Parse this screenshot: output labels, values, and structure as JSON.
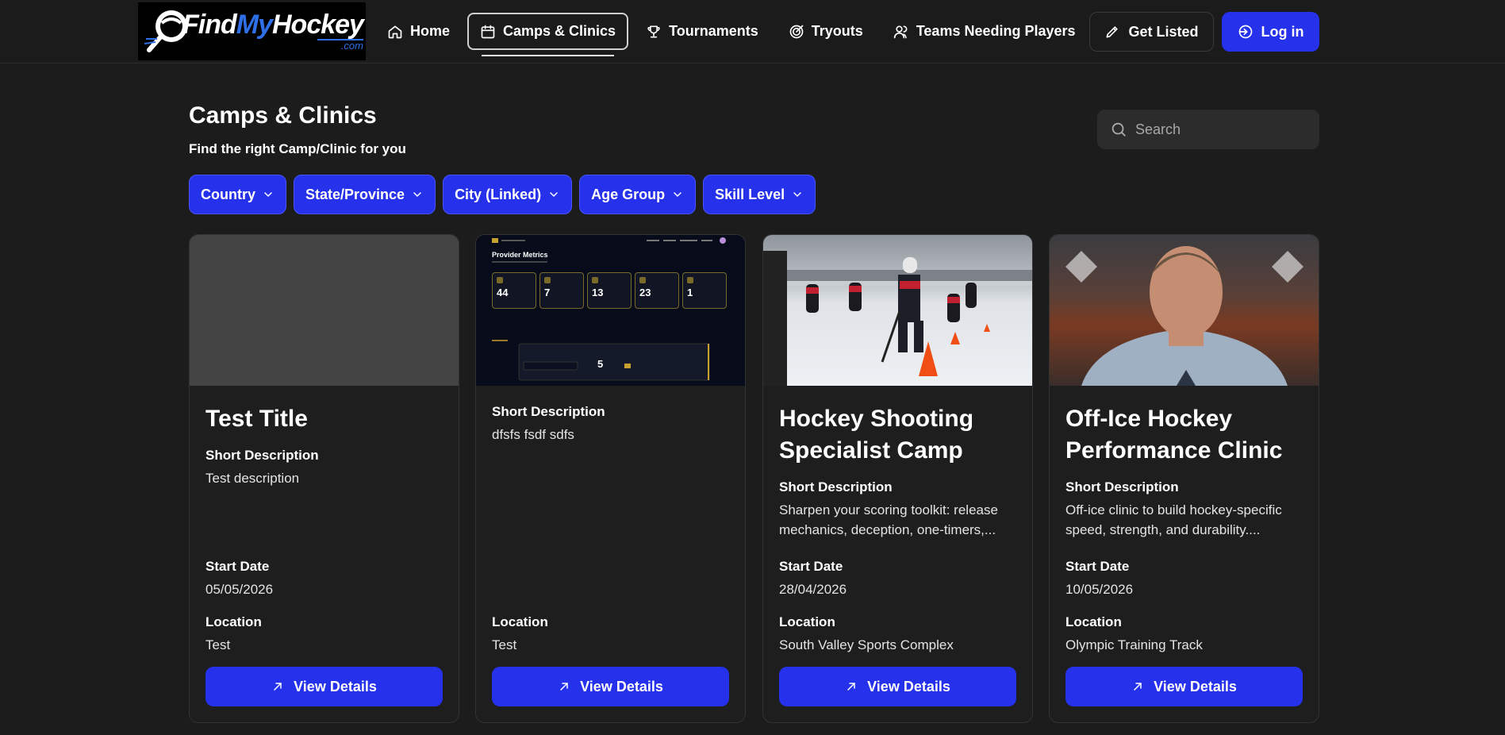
{
  "brand": {
    "logo_main_a": "Find",
    "logo_main_b": "My",
    "logo_main_c": "Hockey",
    "logo_sub": ".com"
  },
  "nav": {
    "items": [
      {
        "label": "Home",
        "icon": "home-icon"
      },
      {
        "label": "Camps & Clinics",
        "icon": "calendar-icon",
        "active": true
      },
      {
        "label": "Tournaments",
        "icon": "trophy-icon"
      },
      {
        "label": "Tryouts",
        "icon": "target-icon"
      },
      {
        "label": "Teams Needing Players",
        "icon": "users-icon"
      }
    ],
    "get_listed": "Get Listed",
    "log_in": "Log in"
  },
  "page": {
    "title": "Camps & Clinics",
    "subtitle": "Find the right Camp/Clinic for you",
    "search_placeholder": "Search"
  },
  "filters": [
    "Country",
    "State/Province",
    "City (Linked)",
    "Age Group",
    "Skill Level"
  ],
  "labels": {
    "short_description": "Short Description",
    "start_date": "Start Date",
    "location": "Location",
    "view_details": "View Details"
  },
  "cards": [
    {
      "title": "Test Title",
      "description": "Test description",
      "start_date": "05/05/2026",
      "location": "Test"
    },
    {
      "title": "",
      "description": "dfsfs fsdf sdfs",
      "start_date": "",
      "location": "Test",
      "thumb": {
        "heading": "Provider Metrics",
        "metrics": [
          "44",
          "7",
          "13",
          "23",
          "1"
        ],
        "stat": "5"
      }
    },
    {
      "title": "Hockey Shooting Specialist Camp",
      "description": "Sharpen your scoring toolkit: release mechanics, deception, one-timers,...",
      "start_date": "28/04/2026",
      "location": "South Valley Sports Complex"
    },
    {
      "title": "Off-Ice Hockey Performance Clinic",
      "description": "Off-ice clinic to build hockey-specific speed, strength, and durability....",
      "start_date": "10/05/2026",
      "location": "Olympic Training Track"
    }
  ],
  "colors": {
    "accent": "#2531ea",
    "background": "#1c1c1c",
    "card": "#1e1e1e"
  }
}
